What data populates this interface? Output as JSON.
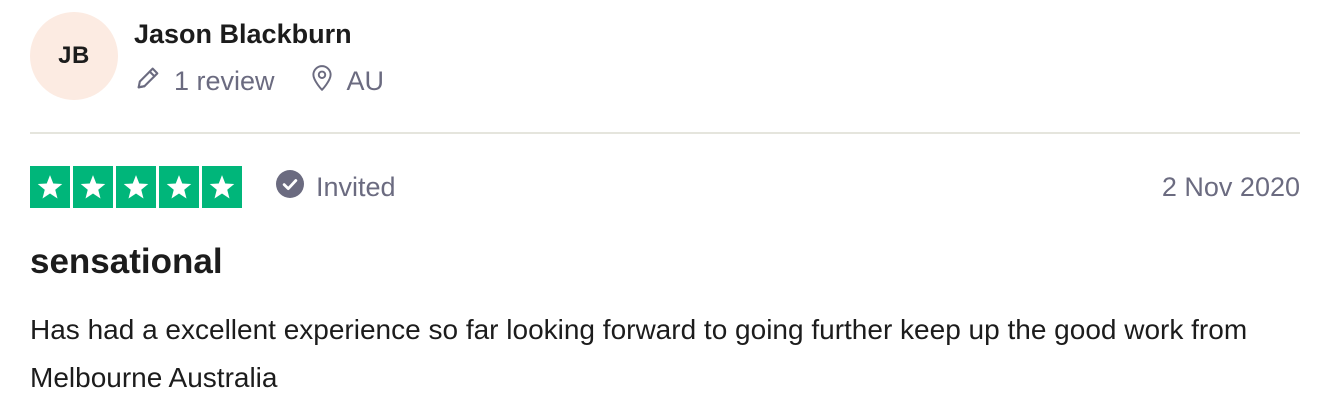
{
  "consumer": {
    "initials": "JB",
    "name": "Jason Blackburn",
    "reviews_count_text": "1 review",
    "location": "AU",
    "avatar_color": "#fcebe2"
  },
  "review": {
    "rating": 5,
    "rating_max": 5,
    "star_color": "#00b67a",
    "verification_label": "Invited",
    "date": "2 Nov 2020",
    "title": "sensational",
    "text": "Has had a excellent experience so far looking forward to going further keep up the good work from Melbourne Australia"
  },
  "icons": {
    "reviews": "pencil-icon",
    "location": "location-pin-icon",
    "verification": "check-circle-icon",
    "star": "star-icon"
  }
}
